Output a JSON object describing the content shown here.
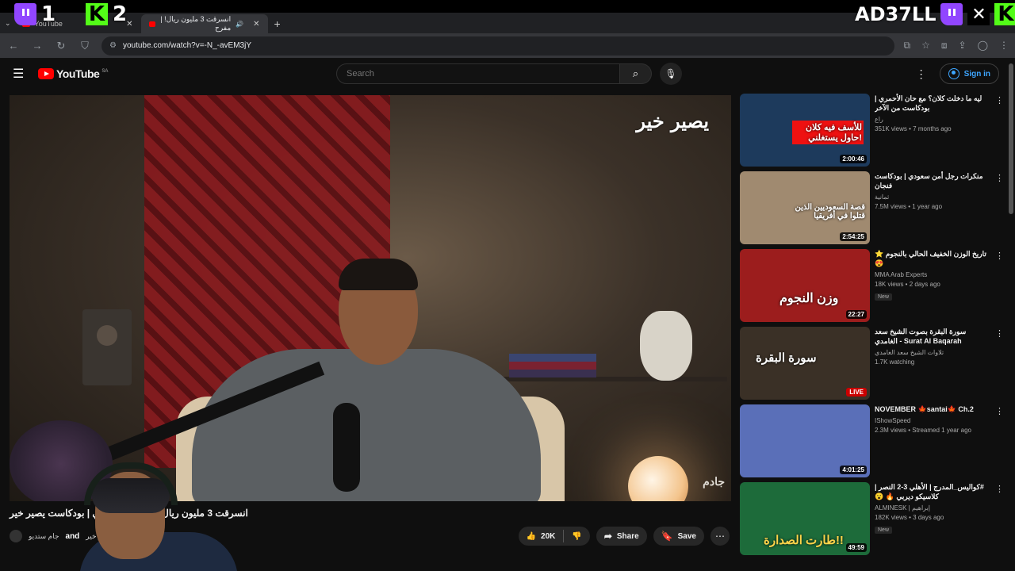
{
  "overlay": {
    "badge1_num": "1",
    "badge2_num": "2",
    "streamer_name": "AD37LL",
    "icons": [
      "twitch-icon",
      "kick-icon",
      "x-icon",
      "kick-icon"
    ]
  },
  "browser": {
    "tabs": [
      {
        "label": "YouTube",
        "active": false
      },
      {
        "label": "انسرقت 3 مليون ريال! | مفرح",
        "active": true
      }
    ],
    "url": "youtube.com/watch?v=-N_-avEM3jY"
  },
  "youtube": {
    "logo_text": "YouTube",
    "country_code": "SA",
    "search_placeholder": "Search",
    "sign_in_label": "Sign in"
  },
  "video": {
    "brand_logo": "يصير خير",
    "corner_logo": "جادم",
    "title": "انسرقت 3 مليون ريال! | مفرح الشقيقي | بودكاست يصير خير",
    "channel_prefix": "جام ستديو",
    "channel_and": "and",
    "channel_suffix": "يصير خير D",
    "likes": "20K",
    "share_label": "Share",
    "save_label": "Save"
  },
  "recommendations": [
    {
      "title": "ليه ما دخلت كلان؟ مع حان الأحمري | بودكاست من الآخر",
      "channel": "راع",
      "stats": "351K views • 7 months ago",
      "duration": "2:00:46",
      "thumb_text": "للأسف فيه كلان حاول يستغلني!",
      "thumb_bg": "#1d3a5c",
      "is_new": false,
      "is_live": false
    },
    {
      "title": "منكرات رجل أمن سعودي | بودكاست فنجان",
      "channel": "ثمانية",
      "stats": "7.5M views • 1 year ago",
      "duration": "2:54:25",
      "thumb_text": "قصة السعوديين الذين قتلوا في أفريقيا",
      "thumb_bg": "#a08a70",
      "is_new": false,
      "is_live": false
    },
    {
      "title": "تاريخ الوزن الخفيف الحالي بالنجوم ⭐ 😍",
      "channel": "MMA Arab Experts",
      "stats": "18K views • 2 days ago",
      "duration": "22:27",
      "thumb_text": "وزن النجوم",
      "thumb_bg": "#9c1d1d",
      "is_new": true,
      "is_live": false
    },
    {
      "title": "سورة البقرة بصوت الشيخ سعد الغامدي - Surat Al Baqarah",
      "channel": "تلاوات الشيخ سعد الغامدي",
      "stats": "1.7K watching",
      "duration": "LIVE",
      "thumb_text": "سورة البقرة",
      "thumb_bg": "#3a3026",
      "is_new": false,
      "is_live": true
    },
    {
      "title": "NOVEMBER 🍁santai🍁 Ch.2",
      "channel": "IShowSpeed",
      "stats": "2.3M views • Streamed 1 year ago",
      "duration": "4:01:25",
      "thumb_text": "",
      "thumb_bg": "#5a6fb8",
      "is_new": false,
      "is_live": false
    },
    {
      "title": "#كواليس_المدرج | الأهلي 3-2 النصر | كلاسيكو ديربي 🔥 😮",
      "channel": "ALMINESK | إبراهيم",
      "stats": "182K views • 3 days ago",
      "duration": "49:59",
      "thumb_text": "طارت الصدارة!!",
      "thumb_bg": "#1d6b3a",
      "is_new": true,
      "is_live": false
    }
  ],
  "new_label": "New"
}
